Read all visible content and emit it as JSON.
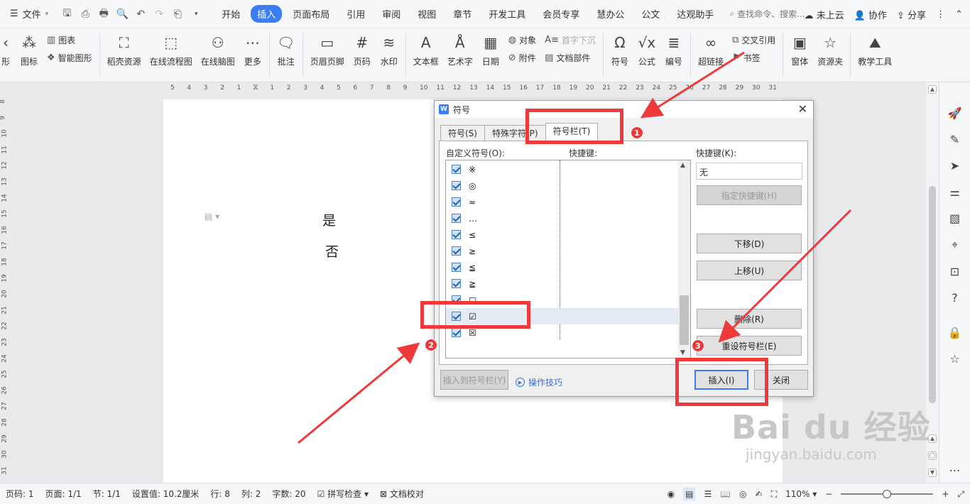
{
  "menubar": {
    "file": "文件",
    "tabs": [
      "开始",
      "插入",
      "页面布局",
      "引用",
      "审阅",
      "视图",
      "章节",
      "开发工具",
      "会员专享",
      "慧办公",
      "公文",
      "达观助手"
    ],
    "active_tab": "插入",
    "search": "查找命令、搜索...",
    "cloud": "未上云",
    "collab": "协作",
    "share": "分享"
  },
  "ribbon": {
    "small_group1": [
      "图表",
      "智能图形"
    ],
    "icon_label": "图标",
    "left_cut": "形",
    "items": [
      "稻壳资源",
      "在线流程图",
      "在线脑图",
      "更多",
      "批注",
      "页眉页脚",
      "页码",
      "水印",
      "文本框",
      "艺术字",
      "日期"
    ],
    "small_group2": [
      "对象",
      "附件"
    ],
    "small_group3": [
      "首字下沉",
      "文档部件"
    ],
    "items2": [
      "符号",
      "公式",
      "编号",
      "超链接"
    ],
    "small_group4": [
      "交叉引用",
      "书签"
    ],
    "items3": [
      "窗体",
      "资源夹",
      "教学工具"
    ]
  },
  "ruler": {
    "h_ticks": [
      "5",
      "4",
      "3",
      "2",
      "1",
      "",
      "1",
      "2",
      "3",
      "4",
      "5",
      "6",
      "7",
      "8",
      "9",
      "10",
      "11",
      "12",
      "13",
      "14",
      "15",
      "16",
      "17",
      "18",
      "19",
      "20",
      "21",
      "22",
      "23",
      "24",
      "25",
      "26",
      "27",
      "28",
      "29",
      "30",
      "31"
    ],
    "v_ticks": [
      "8",
      "9",
      "10",
      "11",
      "12",
      "13",
      "14",
      "15",
      "16",
      "17",
      "18",
      "19",
      "20",
      "21",
      "22",
      "23",
      "24",
      "25",
      "26",
      "27",
      "28",
      "29",
      "30",
      "31"
    ]
  },
  "document": {
    "line1": "是",
    "line2": "否"
  },
  "dialog": {
    "title": "符号",
    "tabs": [
      "符号(S)",
      "特殊字符(P)",
      "符号栏(T)"
    ],
    "active_tab": "符号栏(T)",
    "custom_label": "自定义符号(O):",
    "shortcut_col": "快捷键:",
    "shortcut_label": "快捷键(K):",
    "shortcut_value": "无",
    "symbols": [
      "※",
      "◎",
      "≈",
      "…",
      "≤",
      "≥",
      "≦",
      "≧",
      "□",
      "☑",
      "☒"
    ],
    "selected_symbol": "☑",
    "btn_assign": "指定快捷键(H)",
    "btn_down": "下移(D)",
    "btn_up": "上移(U)",
    "btn_delete": "删除(R)",
    "btn_reset": "重设符号栏(E)",
    "btn_insert_bar": "插入到符号栏(Y)",
    "tips": "操作技巧",
    "btn_insert": "插入(I)",
    "btn_close": "关闭"
  },
  "annotations": {
    "badges": [
      "1",
      "2",
      "3"
    ],
    "color": "#ee3a3a"
  },
  "status": {
    "page_code": "页码: 1",
    "page": "页面: 1/1",
    "section": "节: 1/1",
    "setting": "设置值: 10.2厘米",
    "row": "行: 8",
    "col": "列: 2",
    "words": "字数: 20",
    "spell": "拼写检查",
    "proof": "文档校对",
    "zoom": "110%",
    "zoom_level_percent": 50
  },
  "watermark": {
    "brand": "Bai du 经验",
    "url": "jingyan.baidu.com"
  }
}
